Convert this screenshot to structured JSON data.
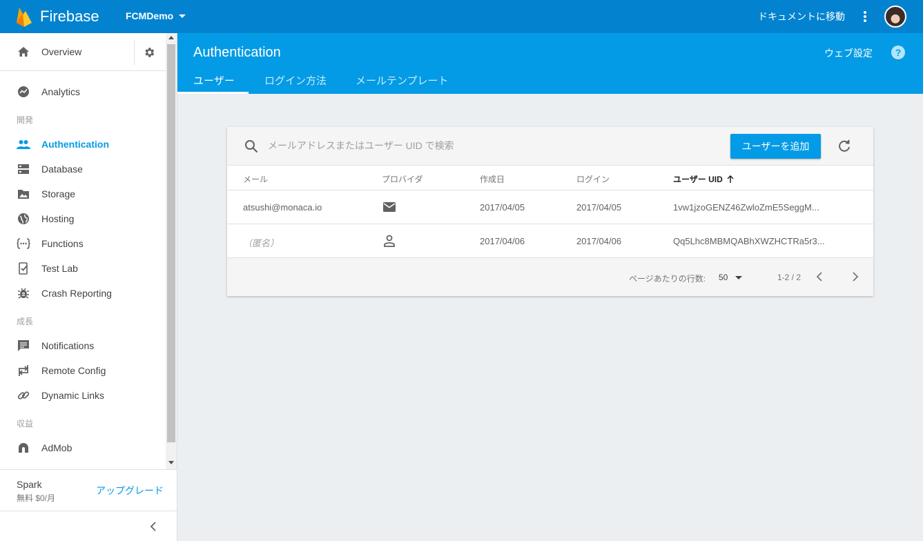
{
  "topbar": {
    "brand": "Firebase",
    "project": "FCMDemo",
    "docs_link": "ドキュメントに移動",
    "colors": {
      "bar": "#0383cf",
      "accent": "#039be5"
    }
  },
  "sidebar": {
    "overview": "Overview",
    "analytics": "Analytics",
    "sections": {
      "develop": "開発",
      "grow": "成長",
      "earn": "収益"
    },
    "develop_items": [
      {
        "label": "Authentication",
        "icon": "people-icon"
      },
      {
        "label": "Database",
        "icon": "database-icon"
      },
      {
        "label": "Storage",
        "icon": "storage-icon"
      },
      {
        "label": "Hosting",
        "icon": "globe-icon"
      },
      {
        "label": "Functions",
        "icon": "functions-icon"
      },
      {
        "label": "Test Lab",
        "icon": "test-lab-icon"
      },
      {
        "label": "Crash Reporting",
        "icon": "bug-icon"
      }
    ],
    "grow_items": [
      {
        "label": "Notifications",
        "icon": "message-icon"
      },
      {
        "label": "Remote Config",
        "icon": "remote-config-icon"
      },
      {
        "label": "Dynamic Links",
        "icon": "link-icon"
      }
    ],
    "earn_items": [
      {
        "label": "AdMob",
        "icon": "admob-icon"
      }
    ],
    "plan": {
      "name": "Spark",
      "price": "無料 $0/月",
      "upgrade": "アップグレード"
    }
  },
  "header": {
    "title": "Authentication",
    "web_setup": "ウェブ設定",
    "help": "?",
    "tabs": [
      "ユーザー",
      "ログイン方法",
      "メールテンプレート"
    ]
  },
  "users": {
    "search_placeholder": "メールアドレスまたはユーザー UID で検索",
    "add_button": "ユーザーを追加",
    "columns": [
      "メール",
      "プロバイダ",
      "作成日",
      "ログイン",
      "ユーザー UID"
    ],
    "rows": [
      {
        "email": "atsushi@monaca.io",
        "provider": "mail-icon",
        "created": "2017/04/05",
        "signed_in": "2017/04/05",
        "uid": "1vw1jzoGENZ46ZwloZmE5SeggM..."
      },
      {
        "email": "（匿名）",
        "provider": "person-icon",
        "created": "2017/04/06",
        "signed_in": "2017/04/06",
        "uid": "Qq5Lhc8MBMQABhXWZHCTRa5r3..."
      }
    ],
    "pagination": {
      "rows_per_page_label": "ページあたりの行数:",
      "rows_per_page": "50",
      "range": "1-2 / 2"
    }
  }
}
